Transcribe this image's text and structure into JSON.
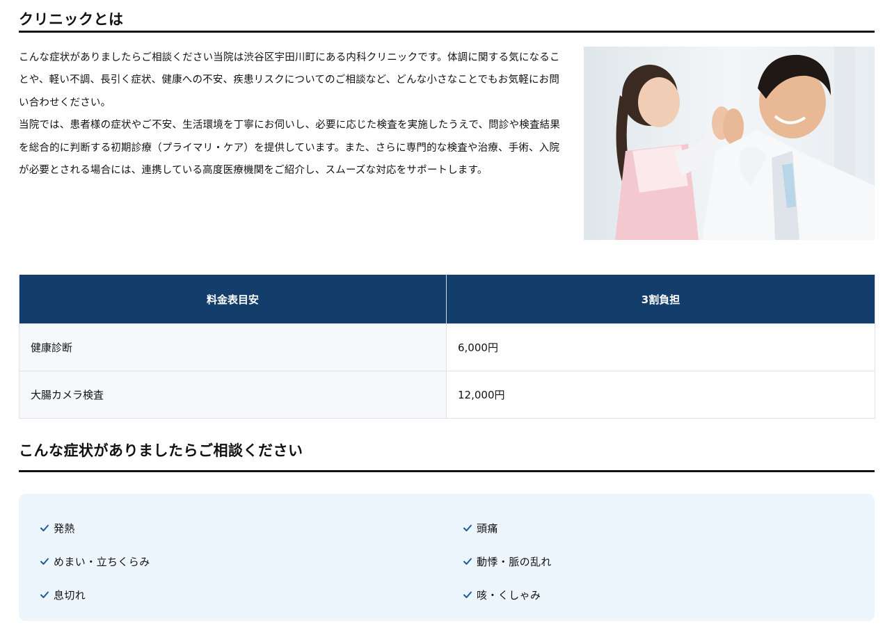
{
  "clinic": {
    "title": "クリニックとは",
    "paragraph1": "こんな症状がありましたらご相談ください当院は渋谷区宇田川町にある内科クリニックです。体調に関する気になることや、軽い不調、長引く症状、健康への不安、疾患リスクについてのご相談など、どんな小さなことでもお気軽にお問い合わせください。",
    "paragraph2": "当院では、患者様の症状やご不安、生活環境を丁寧にお伺いし、必要に応じた検査を実施したうえで、問診や検査結果を総合的に判断する初期診療（プライマリ・ケア）を提供しています。また、さらに専門的な検査や治療、手術、入院が必要とされる場合には、連携している高度医療機関をご紹介し、スムーズな対応をサポートします。"
  },
  "price_table": {
    "headers": [
      "料金表目安",
      "3割負担"
    ],
    "rows": [
      {
        "item": "健康診断",
        "price": "6,000円"
      },
      {
        "item": "大腸カメラ検査",
        "price": "12,000円"
      }
    ]
  },
  "symptoms": {
    "title": "こんな症状がありましたらご相談ください",
    "icon": "check-icon",
    "accent_color": "#1a5a96",
    "items": [
      "発熱",
      "頭痛",
      "めまい・立ちくらみ",
      "動悸・脈の乱れ",
      "息切れ",
      "咳・くしゃみ"
    ]
  },
  "colors": {
    "header_bg": "#133e6b",
    "symptom_bg": "#eef6fd"
  }
}
